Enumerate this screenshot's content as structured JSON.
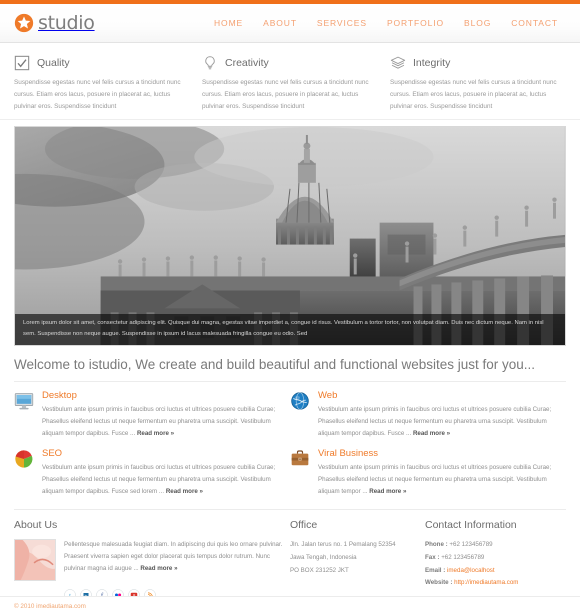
{
  "brand": {
    "name": "studio",
    "accent": "#f0701a",
    "nav_color": "#f4a071"
  },
  "nav": {
    "items": [
      {
        "label": "HOME"
      },
      {
        "label": "ABOUT"
      },
      {
        "label": "SERVICES"
      },
      {
        "label": "PORTFOLIO"
      },
      {
        "label": "BLOG"
      },
      {
        "label": "CONTACT"
      }
    ]
  },
  "features": [
    {
      "icon": "checkbox-icon",
      "title": "Quality",
      "body": "Suspendisse egestas nunc vel felis cursus a tincidunt nunc cursus. Etiam eros lacus, posuere in placerat ac, luctus pulvinar eros. Suspendisse tincidunt"
    },
    {
      "icon": "lightbulb-icon",
      "title": "Creativity",
      "body": "Suspendisse egestas nunc vel felis cursus a tincidunt nunc cursus. Etiam eros lacus, posuere in placerat ac, luctus pulvinar eros. Suspendisse tincidunt"
    },
    {
      "icon": "layers-icon",
      "title": "Integrity",
      "body": "Suspendisse egestas nunc vel felis cursus a tincidunt nunc cursus. Etiam eros lacus, posuere in placerat ac, luctus pulvinar eros. Suspendisse tincidunt"
    }
  ],
  "hero": {
    "alt": "Saint Peters Basilica colonnade black and white photograph",
    "caption": "Lorem ipsum dolor sit amet, consectetur adipiscing elit. Quisque dui magna, egestas vitae imperdiet a, congue id risus. Vestibulum a tortor tortor, non volutpat diam. Duis nec dictum neque. Nam in nisl sem. Suspendisse non neque augue. Suspendisse in ipsum id lacus malesuada fringilla congue eu odio. Sed"
  },
  "welcome": {
    "heading": "Welcome to istudio, We create and build beautiful and functional websites just for you..."
  },
  "services": [
    {
      "icon": "monitor-icon",
      "title": "Desktop",
      "body": "Vestibulum ante ipsum primis in faucibus orci luctus et ultrices posuere cubilia Curae; Phasellus eleifend lectus ut neque fermentum eu pharetra urna suscipit. Vestibulum aliquam tempor dapibus. Fusce ...",
      "readmore": "Read more »"
    },
    {
      "icon": "globe-icon",
      "title": "Web",
      "body": "Vestibulum ante ipsum primis in faucibus orci luctus et ultrices posuere cubilia Curae; Phasellus eleifend lectus ut neque fermentum eu pharetra urna suscipit. Vestibulum aliquam tempor dapibus. Fusce ...",
      "readmore": "Read more »"
    },
    {
      "icon": "pie-chart-icon",
      "title": "SEO",
      "body": "Vestibulum ante ipsum primis in faucibus orci luctus et ultrices posuere cubilia Curae; Phasellus eleifend lectus ut neque fermentum eu pharetra urna suscipit. Vestibulum aliquam tempor dapibus. Fusce sed lorem ...",
      "readmore": "Read more »"
    },
    {
      "icon": "briefcase-icon",
      "title": "Viral Business",
      "body": "Vestibulum ante ipsum primis in faucibus orci luctus et ultrices posuere cubilia Curae; Phasellus eleifend lectus ut neque fermentum eu pharetra urna suscipit. Vestibulum aliquam tempor ...",
      "readmore": "Read more »"
    }
  ],
  "footer": {
    "about": {
      "title": "About Us",
      "body": "Pellentesque malesuada feugiat diam. In adipiscing dui quis leo ornare pulvinar. Praesent viverra sapien eget dolor placerat quis tempus dolor rutrum. Nunc pulvinar magna id augue ...",
      "readmore": "Read more »",
      "social": [
        {
          "name": "twitter-icon",
          "glyph": "t"
        },
        {
          "name": "linkedin-icon",
          "glyph": "in"
        },
        {
          "name": "facebook-icon",
          "glyph": "f"
        },
        {
          "name": "flickr-icon",
          "glyph": "••"
        },
        {
          "name": "youtube-icon",
          "glyph": "▶"
        },
        {
          "name": "rss-icon",
          "glyph": "))"
        }
      ]
    },
    "office": {
      "title": "Office",
      "lines": [
        "Jln. Jalan terus no. 1 Pemalang 52354",
        "Jawa Tengah, Indonesia",
        "PO BOX 231252 JKT"
      ]
    },
    "contact": {
      "title": "Contact Information",
      "phone_label": "Phone :",
      "phone_value": "+62 123456789",
      "fax_label": "Fax :",
      "fax_value": "+62 123456789",
      "email_label": "Email :",
      "email_value": "imeda@localhost",
      "website_label": "Website :",
      "website_value": "http://imediautama.com"
    }
  },
  "copyright": {
    "text": "© 2010 imediautama.com"
  }
}
